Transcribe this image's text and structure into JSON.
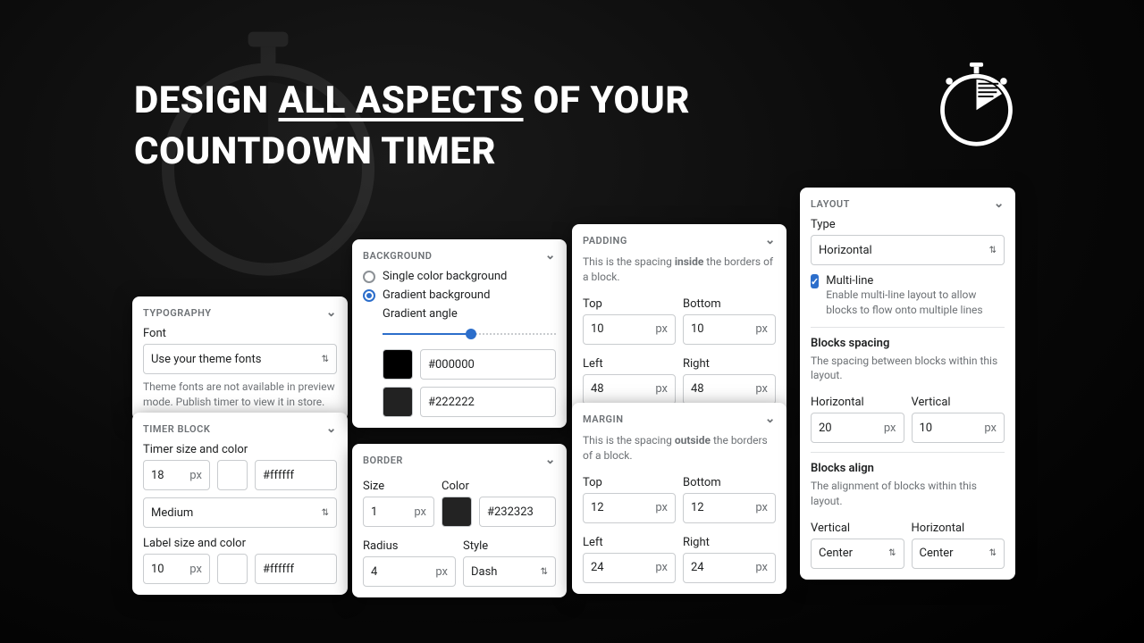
{
  "hero": {
    "pre": "DESIGN ",
    "emph": "ALL ASPECTS",
    "post": " OF YOUR",
    "line2": "COUNTDOWN TIMER"
  },
  "typography": {
    "head": "TYPOGRAPHY",
    "font_label": "Font",
    "font_value": "Use your theme fonts",
    "hint": "Theme fonts are not available in preview mode. Publish timer to view it in store."
  },
  "timer_block": {
    "head": "TIMER BLOCK",
    "size_color_label": "Timer size and color",
    "timer_size": "18",
    "timer_unit": "px",
    "timer_hex": "#ffffff",
    "weight": "Medium",
    "label_size_color_label": "Label size and color",
    "label_size": "10",
    "label_unit": "px",
    "label_hex": "#ffffff"
  },
  "background": {
    "head": "BACKGROUND",
    "opt_single": "Single color background",
    "opt_gradient": "Gradient background",
    "angle_label": "Gradient angle",
    "c1": "#000000",
    "c2": "#222222"
  },
  "border": {
    "head": "BORDER",
    "size_label": "Size",
    "size": "1",
    "size_unit": "px",
    "color_label": "Color",
    "color_hex": "#232323",
    "radius_label": "Radius",
    "radius": "4",
    "radius_unit": "px",
    "style_label": "Style",
    "style": "Dash"
  },
  "padding": {
    "head": "PADDING",
    "hint_a": "This is the spacing ",
    "hint_b": "inside",
    "hint_c": " the borders of a block.",
    "top_l": "Top",
    "top": "10",
    "bottom_l": "Bottom",
    "bottom": "10",
    "left_l": "Left",
    "left": "48",
    "right_l": "Right",
    "right": "48",
    "unit": "px"
  },
  "margin": {
    "head": "MARGIN",
    "hint_a": "This is the spacing ",
    "hint_b": "outside",
    "hint_c": " the borders of a block.",
    "top_l": "Top",
    "top": "12",
    "bottom_l": "Bottom",
    "bottom": "12",
    "left_l": "Left",
    "left": "24",
    "right_l": "Right",
    "right": "24",
    "unit": "px"
  },
  "layout": {
    "head": "LAYOUT",
    "type_l": "Type",
    "type": "Horizontal",
    "ml_label": "Multi-line",
    "ml_hint": "Enable multi-line layout to allow blocks to flow onto multiple lines",
    "spacing_head": "Blocks spacing",
    "spacing_hint": "The spacing between blocks within this layout.",
    "h_l": "Horizontal",
    "h": "20",
    "v_l": "Vertical",
    "v": "10",
    "unit": "px",
    "align_head": "Blocks align",
    "align_hint": "The alignment of blocks within this layout.",
    "valign_l": "Vertical",
    "valign": "Center",
    "halign_l": "Horizontal",
    "halign": "Center"
  }
}
